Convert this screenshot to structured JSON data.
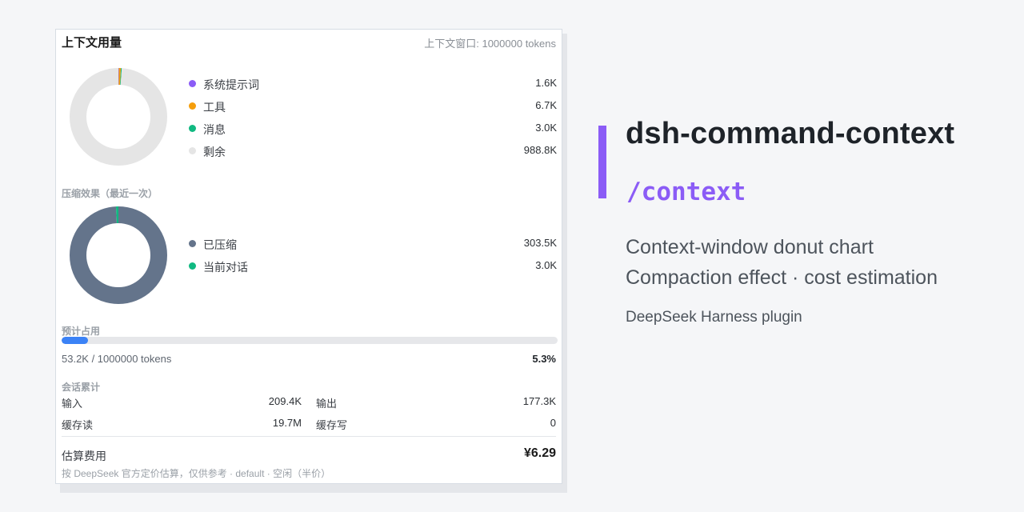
{
  "card": {
    "title": "上下文用量",
    "window_info": "上下文窗口: 1000000 tokens",
    "context_chart": {
      "legend": [
        {
          "label": "系统提示词",
          "value": "1.6K",
          "color": "#8b5cf6"
        },
        {
          "label": "工具",
          "value": "6.7K",
          "color": "#f59e0b"
        },
        {
          "label": "消息",
          "value": "3.0K",
          "color": "#10b981"
        },
        {
          "label": "剩余",
          "value": "988.8K",
          "color": "#e5e5e5"
        }
      ]
    },
    "compaction": {
      "title": "压缩效果（最近一次）",
      "legend": [
        {
          "label": "已压缩",
          "value": "303.5K",
          "color": "#64748b"
        },
        {
          "label": "当前对话",
          "value": "3.0K",
          "color": "#10b981"
        }
      ]
    },
    "estimate": {
      "title": "预计占用",
      "usage_text": "53.2K / 1000000 tokens",
      "percent_text": "5.3%",
      "fraction": 0.053,
      "bar_color": "#3b82f6"
    },
    "session": {
      "title": "会话累计",
      "input_label": "输入",
      "input_value": "209.4K",
      "output_label": "输出",
      "output_value": "177.3K",
      "cache_read_label": "缓存读",
      "cache_read_value": "19.7M",
      "cache_write_label": "缓存写",
      "cache_write_value": "0"
    },
    "cost": {
      "label": "估算费用",
      "value": "¥6.29",
      "note": "按 DeepSeek 官方定价估算，仅供参考 · default · 空闲（半价）"
    }
  },
  "chart_data": [
    {
      "type": "pie",
      "donut": true,
      "categories": [
        "系统提示词",
        "工具",
        "消息",
        "剩余"
      ],
      "values": [
        1.6,
        6.7,
        3.0,
        988.8
      ],
      "colors": [
        "#8b5cf6",
        "#f59e0b",
        "#10b981",
        "#e5e5e5"
      ]
    },
    {
      "type": "pie",
      "donut": true,
      "categories": [
        "已压缩",
        "当前对话"
      ],
      "values": [
        303.5,
        3.0
      ],
      "colors": [
        "#64748b",
        "#10b981"
      ]
    }
  ],
  "plugin": {
    "name": "dsh-command-context",
    "command": "/context",
    "description_line1": "Context-window donut chart",
    "description_line2": "Compaction effect · cost estimation",
    "subtitle": "DeepSeek Harness plugin",
    "accent_color": "#8b5cf6"
  }
}
